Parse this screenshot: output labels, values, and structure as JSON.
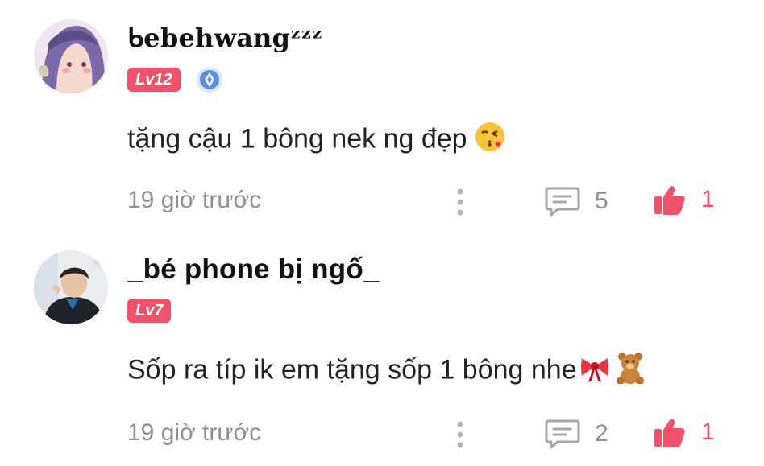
{
  "comments": [
    {
      "username": "ᑲebehwangᶻᶻᶻ",
      "level": "Lv12",
      "has_badge": true,
      "text": "tặng cậu 1 bông nek ng đẹp",
      "emoji": "face-blowing-kiss",
      "time": "19 giờ trước",
      "reply_count": "5",
      "like_count": "1"
    },
    {
      "username": "_bé phone bị ngố_",
      "level": "Lv7",
      "has_badge": false,
      "text": "Sốp ra típ ik em tặng sốp 1 bông nhe",
      "emoji": "ribbon, teddy-bear",
      "time": "19 giờ trước",
      "reply_count": "2",
      "like_count": "1"
    }
  ],
  "colors": {
    "accent": "#f0516b",
    "muted": "#8f8f8f"
  }
}
